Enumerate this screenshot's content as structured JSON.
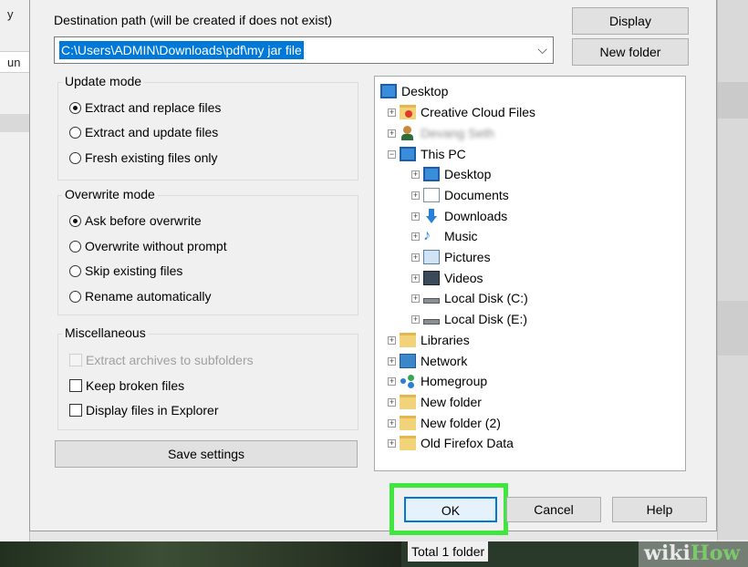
{
  "background": {
    "left_labels": [
      "y",
      "un"
    ]
  },
  "dialog": {
    "destination_label": "Destination path (will be created if does not exist)",
    "destination_value": "C:\\Users\\ADMIN\\Downloads\\pdf\\my jar file",
    "display_button": "Display",
    "new_folder_button": "New folder",
    "update_mode": {
      "title": "Update mode",
      "options": [
        "Extract and replace files",
        "Extract and update files",
        "Fresh existing files only"
      ],
      "selected_index": 0
    },
    "overwrite_mode": {
      "title": "Overwrite mode",
      "options": [
        "Ask before overwrite",
        "Overwrite without prompt",
        "Skip existing files",
        "Rename automatically"
      ],
      "selected_index": 0
    },
    "miscellaneous": {
      "title": "Miscellaneous",
      "options": [
        "Extract archives to subfolders",
        "Keep broken files",
        "Display files in Explorer"
      ]
    },
    "save_settings_button": "Save settings",
    "tree": {
      "items": [
        {
          "label": "Desktop",
          "icon": "desktop-icon"
        },
        {
          "label": "Creative Cloud Files",
          "icon": "creative-cloud-icon"
        },
        {
          "label": "Devang Seth",
          "icon": "user-icon"
        },
        {
          "label": "This PC",
          "icon": "this-pc-icon"
        },
        {
          "label": "Desktop",
          "icon": "desktop-icon"
        },
        {
          "label": "Documents",
          "icon": "documents-icon"
        },
        {
          "label": "Downloads",
          "icon": "downloads-icon"
        },
        {
          "label": "Music",
          "icon": "music-icon"
        },
        {
          "label": "Pictures",
          "icon": "pictures-icon"
        },
        {
          "label": "Videos",
          "icon": "videos-icon"
        },
        {
          "label": "Local Disk (C:)",
          "icon": "disk-icon"
        },
        {
          "label": "Local Disk (E:)",
          "icon": "disk-icon"
        },
        {
          "label": "Libraries",
          "icon": "libraries-icon"
        },
        {
          "label": "Network",
          "icon": "network-icon"
        },
        {
          "label": "Homegroup",
          "icon": "homegroup-icon"
        },
        {
          "label": "New folder",
          "icon": "folder-icon"
        },
        {
          "label": "New folder (2)",
          "icon": "folder-icon"
        },
        {
          "label": "Old Firefox Data",
          "icon": "folder-icon"
        }
      ]
    },
    "ok_button": "OK",
    "cancel_button": "Cancel",
    "help_button": "Help"
  },
  "status_bar": {
    "text": "Total 1 folder"
  },
  "watermark": {
    "part1": "wiki",
    "part2": "How"
  },
  "colors": {
    "selection": "#0078d7",
    "highlight": "#3ee63e"
  }
}
